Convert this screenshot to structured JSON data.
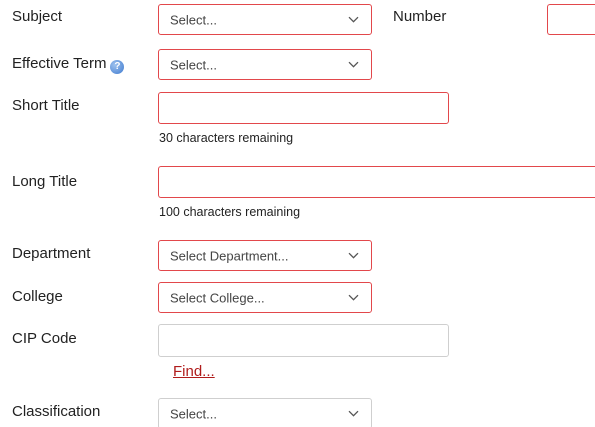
{
  "subject": {
    "label": "Subject",
    "value": "Select..."
  },
  "number": {
    "label": "Number",
    "value": ""
  },
  "effective_term": {
    "label": "Effective Term",
    "help_icon": "help-icon",
    "value": "Select..."
  },
  "short_title": {
    "label": "Short Title",
    "value": "",
    "hint": "30 characters remaining"
  },
  "long_title": {
    "label": "Long Title",
    "value": "",
    "hint": "100 characters remaining"
  },
  "department": {
    "label": "Department",
    "value": "Select Department..."
  },
  "college": {
    "label": "College",
    "value": "Select College..."
  },
  "cip_code": {
    "label": "CIP Code",
    "value": "",
    "find_link": "Find..."
  },
  "classification": {
    "label": "Classification",
    "value": "Select..."
  },
  "colors": {
    "invalid_border": "#e2474b",
    "normal_border": "#cfcfcf",
    "link": "#b01c1c"
  }
}
